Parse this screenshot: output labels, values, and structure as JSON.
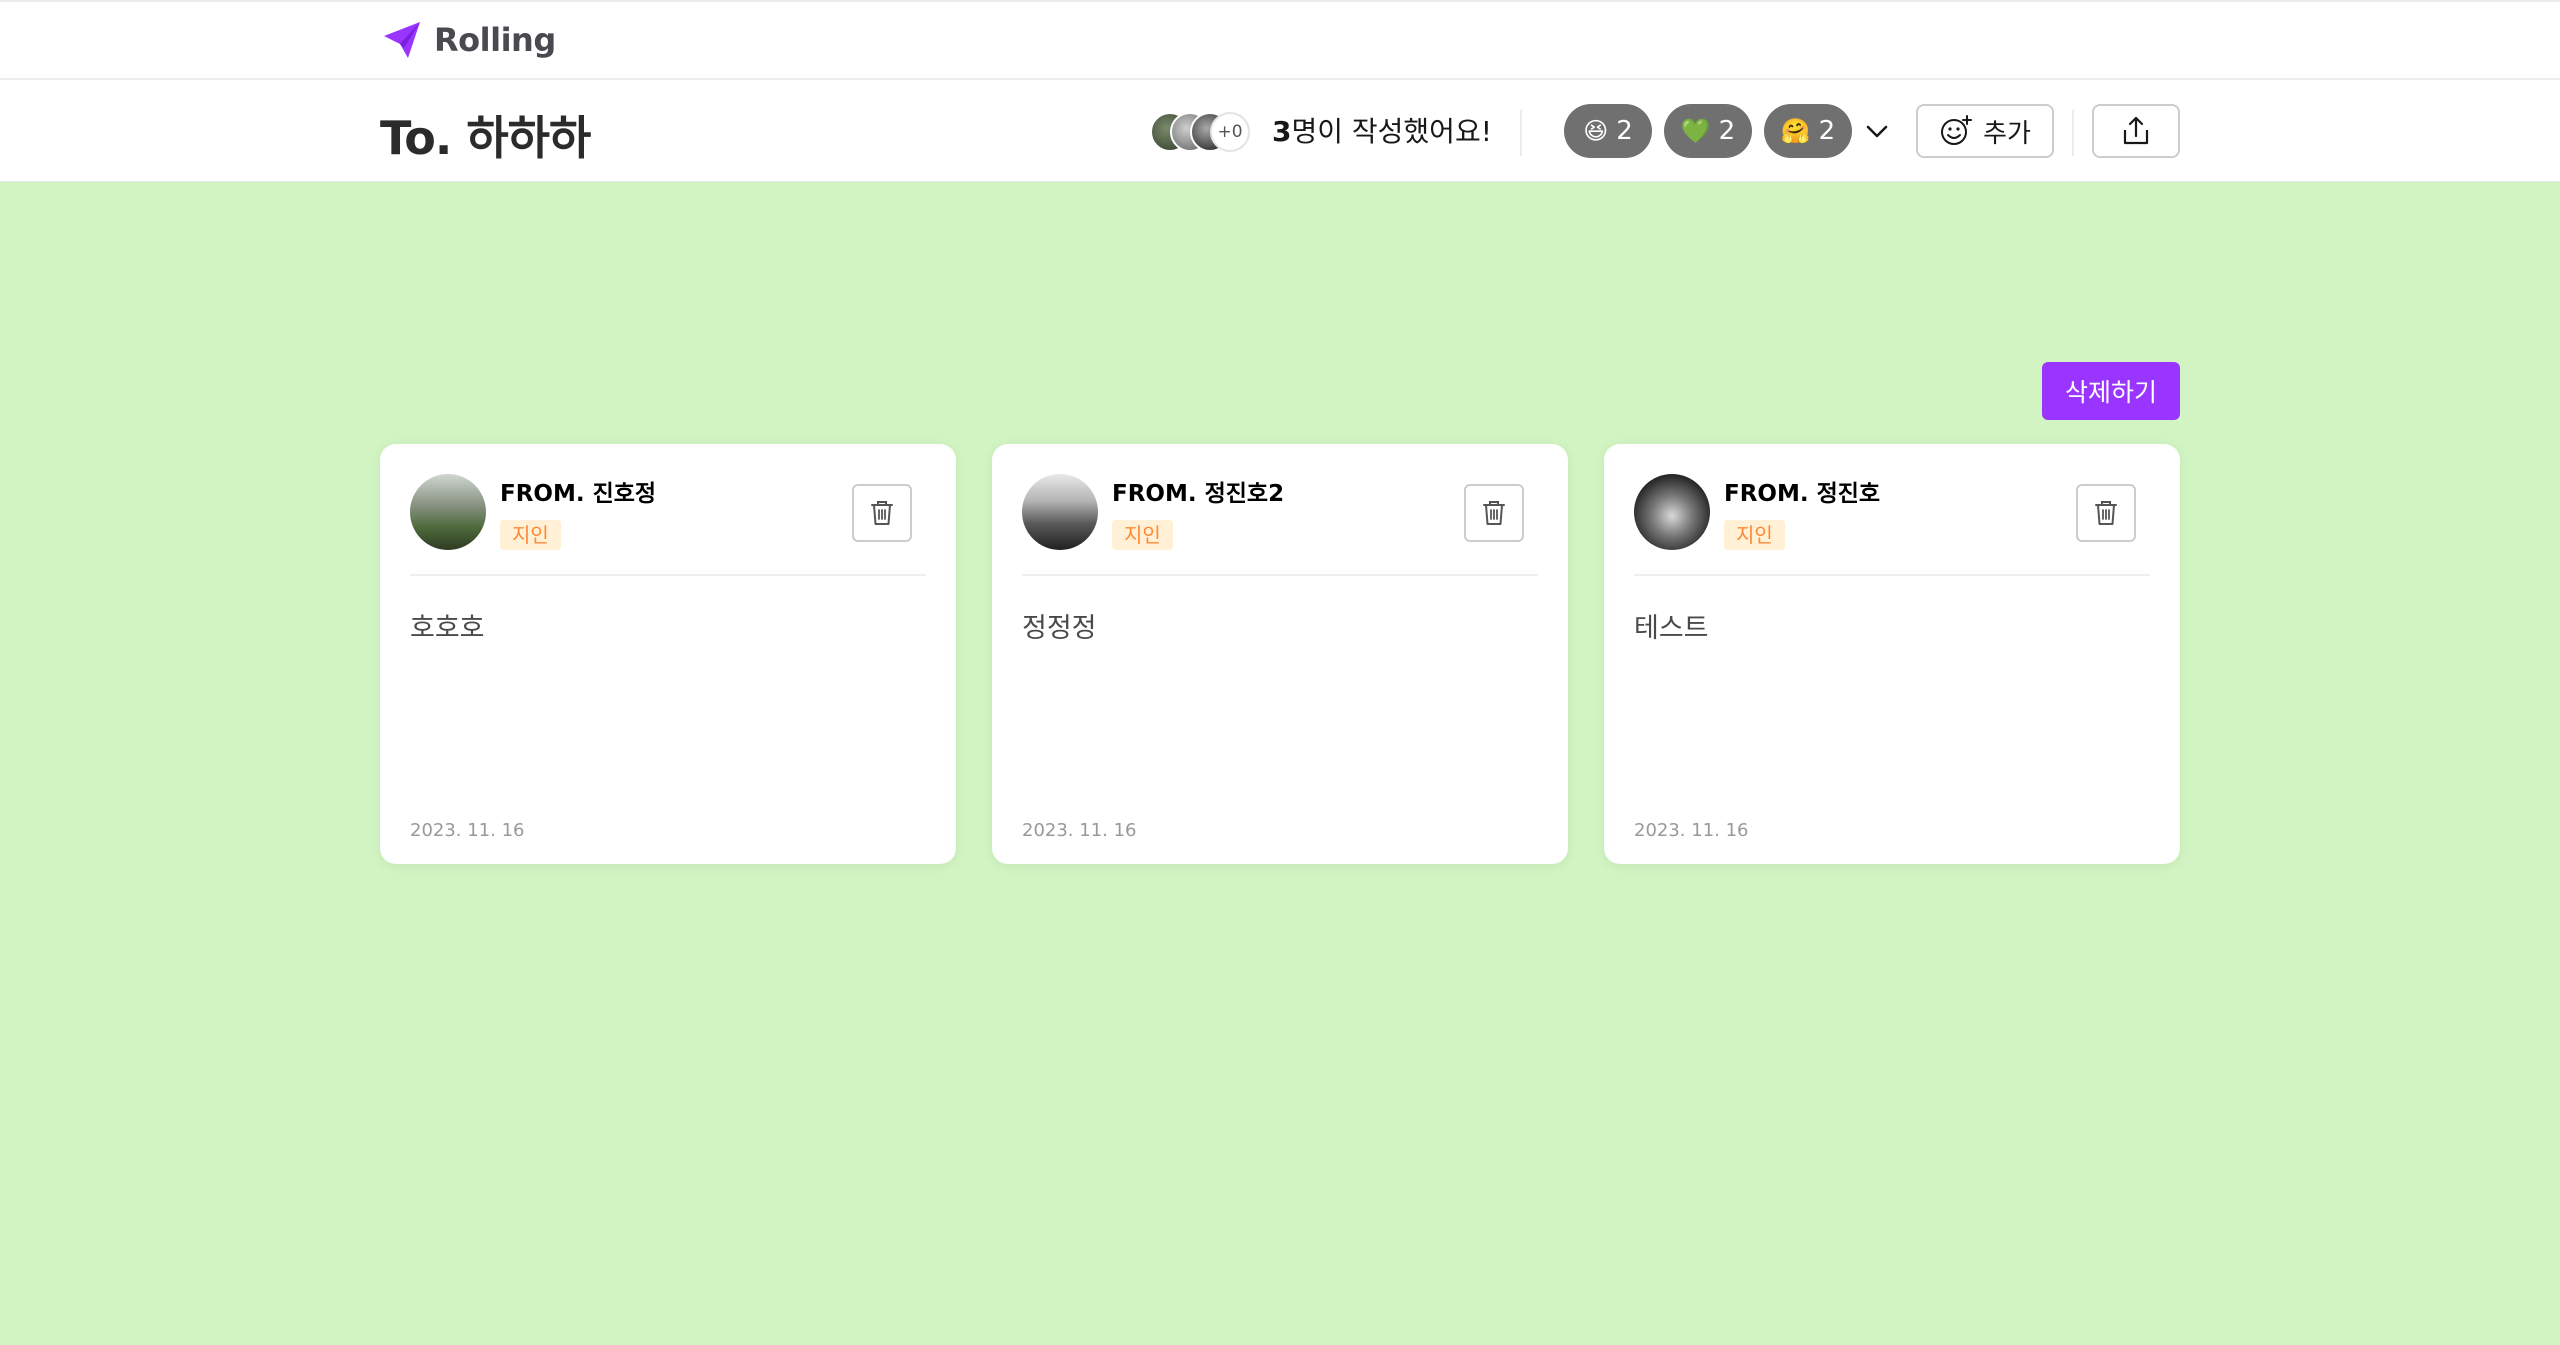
{
  "nav": {
    "logo_text": "Rolling",
    "brand_color": "#9935ff"
  },
  "header": {
    "title": "To. 하하하",
    "avatar_more": "+0",
    "writer_count": "3",
    "writer_suffix": "명이 작성했어요!",
    "reactions": [
      {
        "emoji": "😆",
        "icon": "laughing-emoji-icon",
        "count": "2"
      },
      {
        "emoji": "💚",
        "icon": "green-heart-emoji-icon",
        "count": "2"
      },
      {
        "emoji": "🤗",
        "icon": "hugging-emoji-icon",
        "count": "2"
      }
    ],
    "add_label": "추가"
  },
  "main": {
    "background_color": "#d1f4c2",
    "delete_all_label": "삭제하기",
    "cards": [
      {
        "from": "FROM. 진호정",
        "relation": "지인",
        "content": "호호호",
        "date": "2023. 11. 16"
      },
      {
        "from": "FROM. 정진호2",
        "relation": "지인",
        "content": "정정정",
        "date": "2023. 11. 16"
      },
      {
        "from": "FROM. 정진호",
        "relation": "지인",
        "content": "테스트",
        "date": "2023. 11. 16"
      }
    ]
  }
}
